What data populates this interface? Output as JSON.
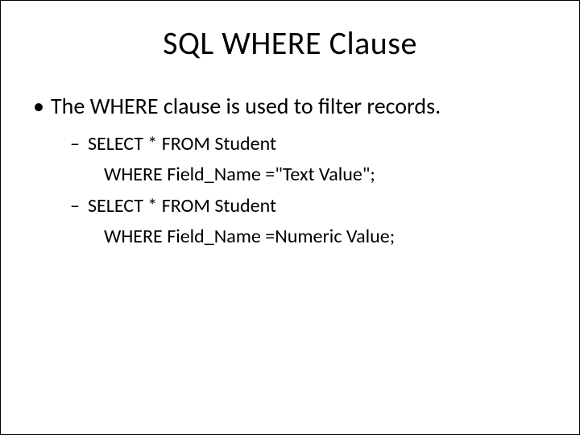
{
  "title": "SQL WHERE Clause",
  "body": {
    "point": "The WHERE clause is used to filter records.",
    "examples": {
      "ex1": {
        "line1": "SELECT * FROM Student",
        "line2": "WHERE Field_Name =\"Text Value\";"
      },
      "ex2": {
        "line1": "SELECT * FROM Student",
        "line2": "WHERE Field_Name =Numeric Value;"
      }
    }
  }
}
